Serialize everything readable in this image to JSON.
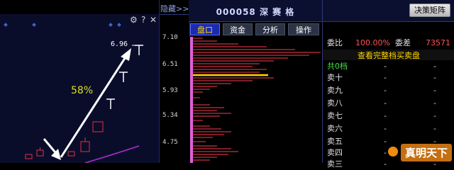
{
  "chart": {
    "pct_label": "58%",
    "price_label": "6.96",
    "tools": [
      "gear-icon",
      "help-icon",
      "close-icon"
    ]
  },
  "axis": {
    "hide_label": "隐藏>>",
    "ticks": [
      "7.10",
      "6.51",
      "5.93",
      "5.34",
      "4.75"
    ]
  },
  "header": {
    "stock_title": "000058 深 赛 格",
    "decision_button": "决策矩阵"
  },
  "tabs": [
    "盘口",
    "资金",
    "分析",
    "操作"
  ],
  "committee": {
    "ratio_label": "委比",
    "ratio_value": "100.00%",
    "diff_label": "委差",
    "diff_value": "73571"
  },
  "full_book_link": "查看完整档买卖盘",
  "order_rows": [
    {
      "label": "共0档",
      "cols": [
        "-",
        "-"
      ]
    },
    {
      "label": "卖十",
      "cols": [
        "-",
        "-"
      ]
    },
    {
      "label": "卖九",
      "cols": [
        "-",
        "-"
      ]
    },
    {
      "label": "卖八",
      "cols": [
        "-",
        "-"
      ]
    },
    {
      "label": "卖七",
      "cols": [
        "-",
        "-"
      ]
    },
    {
      "label": "卖六",
      "cols": [
        "-",
        "-"
      ]
    },
    {
      "label": "卖五",
      "cols": [
        "-",
        "-"
      ]
    },
    {
      "label": "卖四",
      "cols": [
        "-",
        "-"
      ]
    },
    {
      "label": "卖三",
      "cols": [
        "-",
        "-"
      ]
    }
  ],
  "watermark": "真明天下",
  "colors": {
    "up": "#ff4040",
    "accent_blue": "#1b2bb0",
    "highlight_yellow": "#ffd700",
    "tab_active_text": "#ffd700"
  }
}
